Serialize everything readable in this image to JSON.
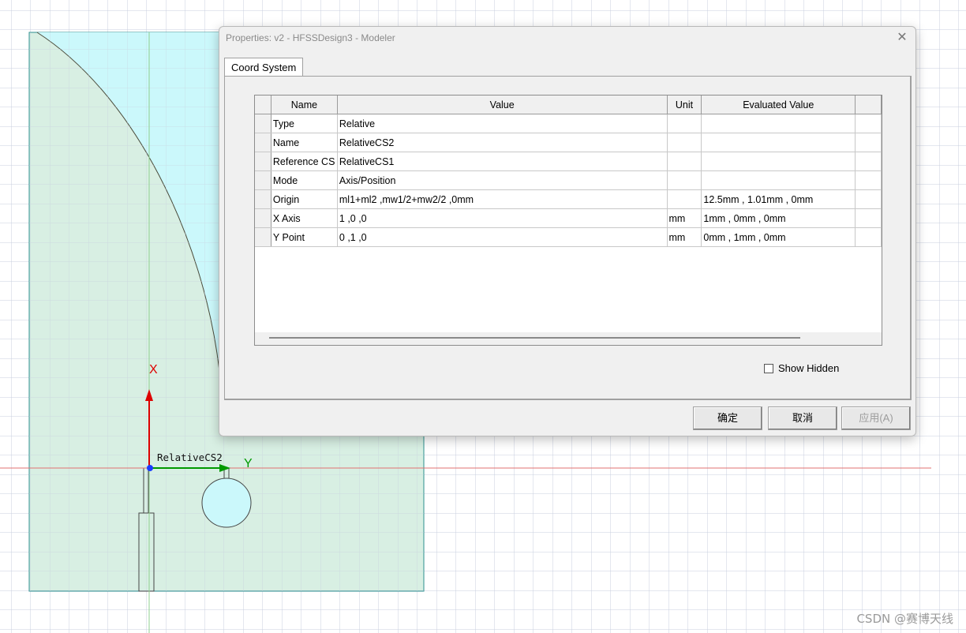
{
  "dialog": {
    "title": "Properties: v2 - HFSSDesign3 - Modeler",
    "close_glyph": "✕",
    "tab_label": "Coord System",
    "columns": [
      "Name",
      "Value",
      "Unit",
      "Evaluated Value"
    ],
    "rows": [
      {
        "name": "Type",
        "value": "Relative",
        "unit": "",
        "evaluated": ""
      },
      {
        "name": "Name",
        "value": "RelativeCS2",
        "unit": "",
        "evaluated": ""
      },
      {
        "name": "Reference CS",
        "value": "RelativeCS1",
        "unit": "",
        "evaluated": ""
      },
      {
        "name": "Mode",
        "value": "Axis/Position",
        "unit": "",
        "evaluated": ""
      },
      {
        "name": "Origin",
        "value": "ml1+ml2 ,mw1/2+mw2/2 ,0mm",
        "unit": "",
        "evaluated": "12.5mm , 1.01mm , 0mm"
      },
      {
        "name": "X Axis",
        "value": "1 ,0 ,0",
        "unit": "mm",
        "evaluated": "1mm , 0mm , 0mm"
      },
      {
        "name": "Y Point",
        "value": "0 ,1 ,0",
        "unit": "mm",
        "evaluated": "0mm , 1mm , 0mm"
      }
    ],
    "show_hidden_label": "Show Hidden",
    "show_hidden_checked": false,
    "buttons": {
      "ok": "确定",
      "cancel": "取消",
      "apply": "应用(A)"
    }
  },
  "canvas": {
    "x_axis_label": "X",
    "y_axis_label": "Y",
    "cs_label": "RelativeCS2",
    "colors": {
      "substrate": "#d4ede0",
      "patch": "#cbf8fb",
      "grid": "#c9cfdf",
      "x_axis": "#dd0000",
      "y_axis": "#009900",
      "origin": "#1a3cff"
    }
  },
  "watermark": "CSDN @赛博天线"
}
